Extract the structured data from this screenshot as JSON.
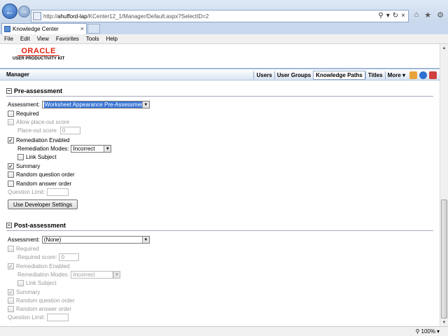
{
  "browser": {
    "url_prefix": "http://",
    "url_host": "ahufford-lap",
    "url_path": "/KCenter12_1/Manager/Default.aspx?SelectID=2",
    "tab_title": "Knowledge Center",
    "zoom": "100%",
    "menu": [
      "File",
      "Edit",
      "View",
      "Favorites",
      "Tools",
      "Help"
    ]
  },
  "brand": {
    "logo": "ORACLE",
    "product": "USER PRODUCTIVITY KIT"
  },
  "app_bar": {
    "title": "Manager",
    "links": [
      "Users",
      "User Groups",
      "Knowledge Paths",
      "Titles",
      "More"
    ],
    "active": "Knowledge Paths"
  },
  "pre": {
    "heading": "Pre-assessment",
    "assessment_label": "Assessment:",
    "assessment_value": "Worksheet Appearance Pre-Assessment",
    "required": "Required",
    "allow_placeout": "Allow place-out score",
    "placeout_label": "Place-out score:",
    "placeout_value": "0",
    "remediation_enabled": "Remediation Enabled",
    "remediation_modes_label": "Remediation Modes:",
    "remediation_modes_value": "Incorrect",
    "link_subject": "Link Subject",
    "summary": "Summary",
    "random_question": "Random question order",
    "random_answer": "Random answer order",
    "question_limit": "Question Limit:",
    "dev_button": "Use Developer Settings"
  },
  "post": {
    "heading": "Post-assessment",
    "assessment_label": "Assessment:",
    "assessment_value": "(None)",
    "required": "Required",
    "required_score_label": "Required score:",
    "required_score_value": "0",
    "remediation_enabled": "Remediation Enabled",
    "remediation_modes_label": "Remediation Modes:",
    "remediation_modes_value": "Incorrect",
    "link_subject": "Link Subject",
    "summary": "Summary",
    "random_question": "Random question order",
    "random_answer": "Random answer order",
    "question_limit": "Question Limit:"
  }
}
